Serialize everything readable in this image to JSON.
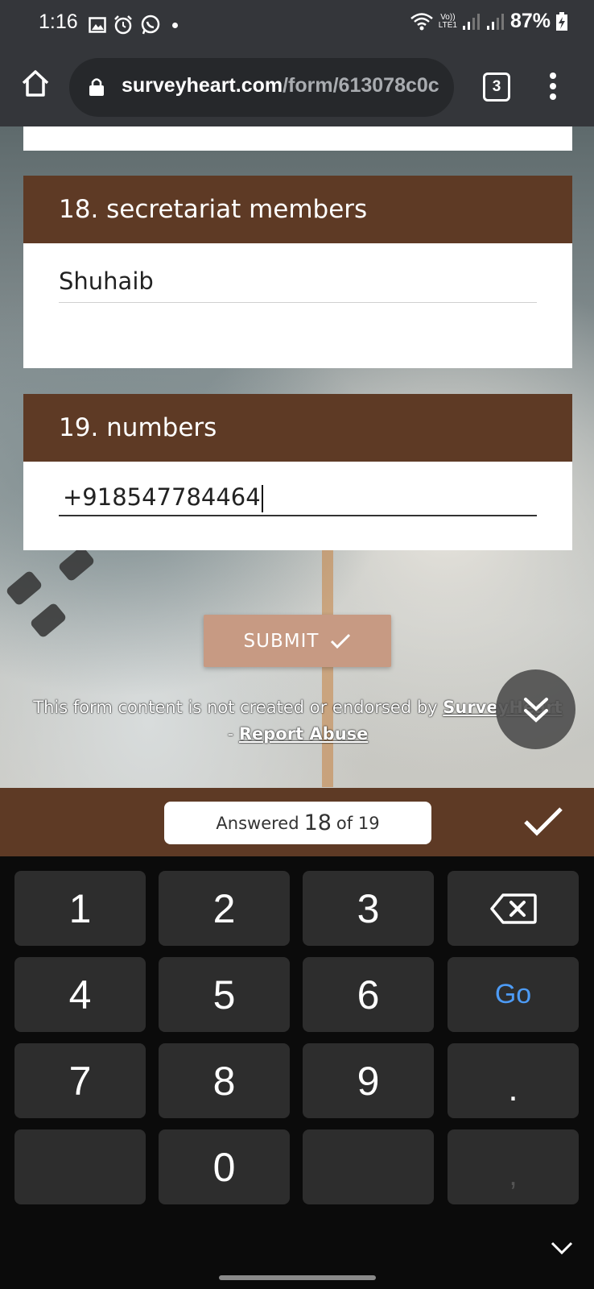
{
  "status_bar": {
    "time": "1:16",
    "lte_top": "Vo))",
    "lte_bottom": "LTE1",
    "battery": "87%"
  },
  "browser": {
    "url_host": "surveyheart.com",
    "url_path": "/form/613078c0c",
    "tab_count": "3"
  },
  "form": {
    "questions": [
      {
        "title": "18. secretariat members",
        "answer": "Shuhaib"
      },
      {
        "title": "19. numbers",
        "answer": "+918547784464"
      }
    ],
    "submit_label": "SUBMIT",
    "disclaimer_text": "This form content is not created or endorsed by",
    "disclaimer_brand": "SurveyHeart",
    "disclaimer_dash": "-",
    "report_abuse": "Report Abuse"
  },
  "progress": {
    "prefix": "Answered",
    "answered": "18",
    "suffix": "of 19"
  },
  "keyboard": {
    "keys": [
      "1",
      "2",
      "3",
      "4",
      "5",
      "6",
      "Go",
      "7",
      "8",
      "9",
      ".",
      "0",
      ","
    ]
  },
  "colors": {
    "header_brown": "#5e3a25",
    "submit": "#c79a83",
    "go_key": "#4d9bf5"
  }
}
